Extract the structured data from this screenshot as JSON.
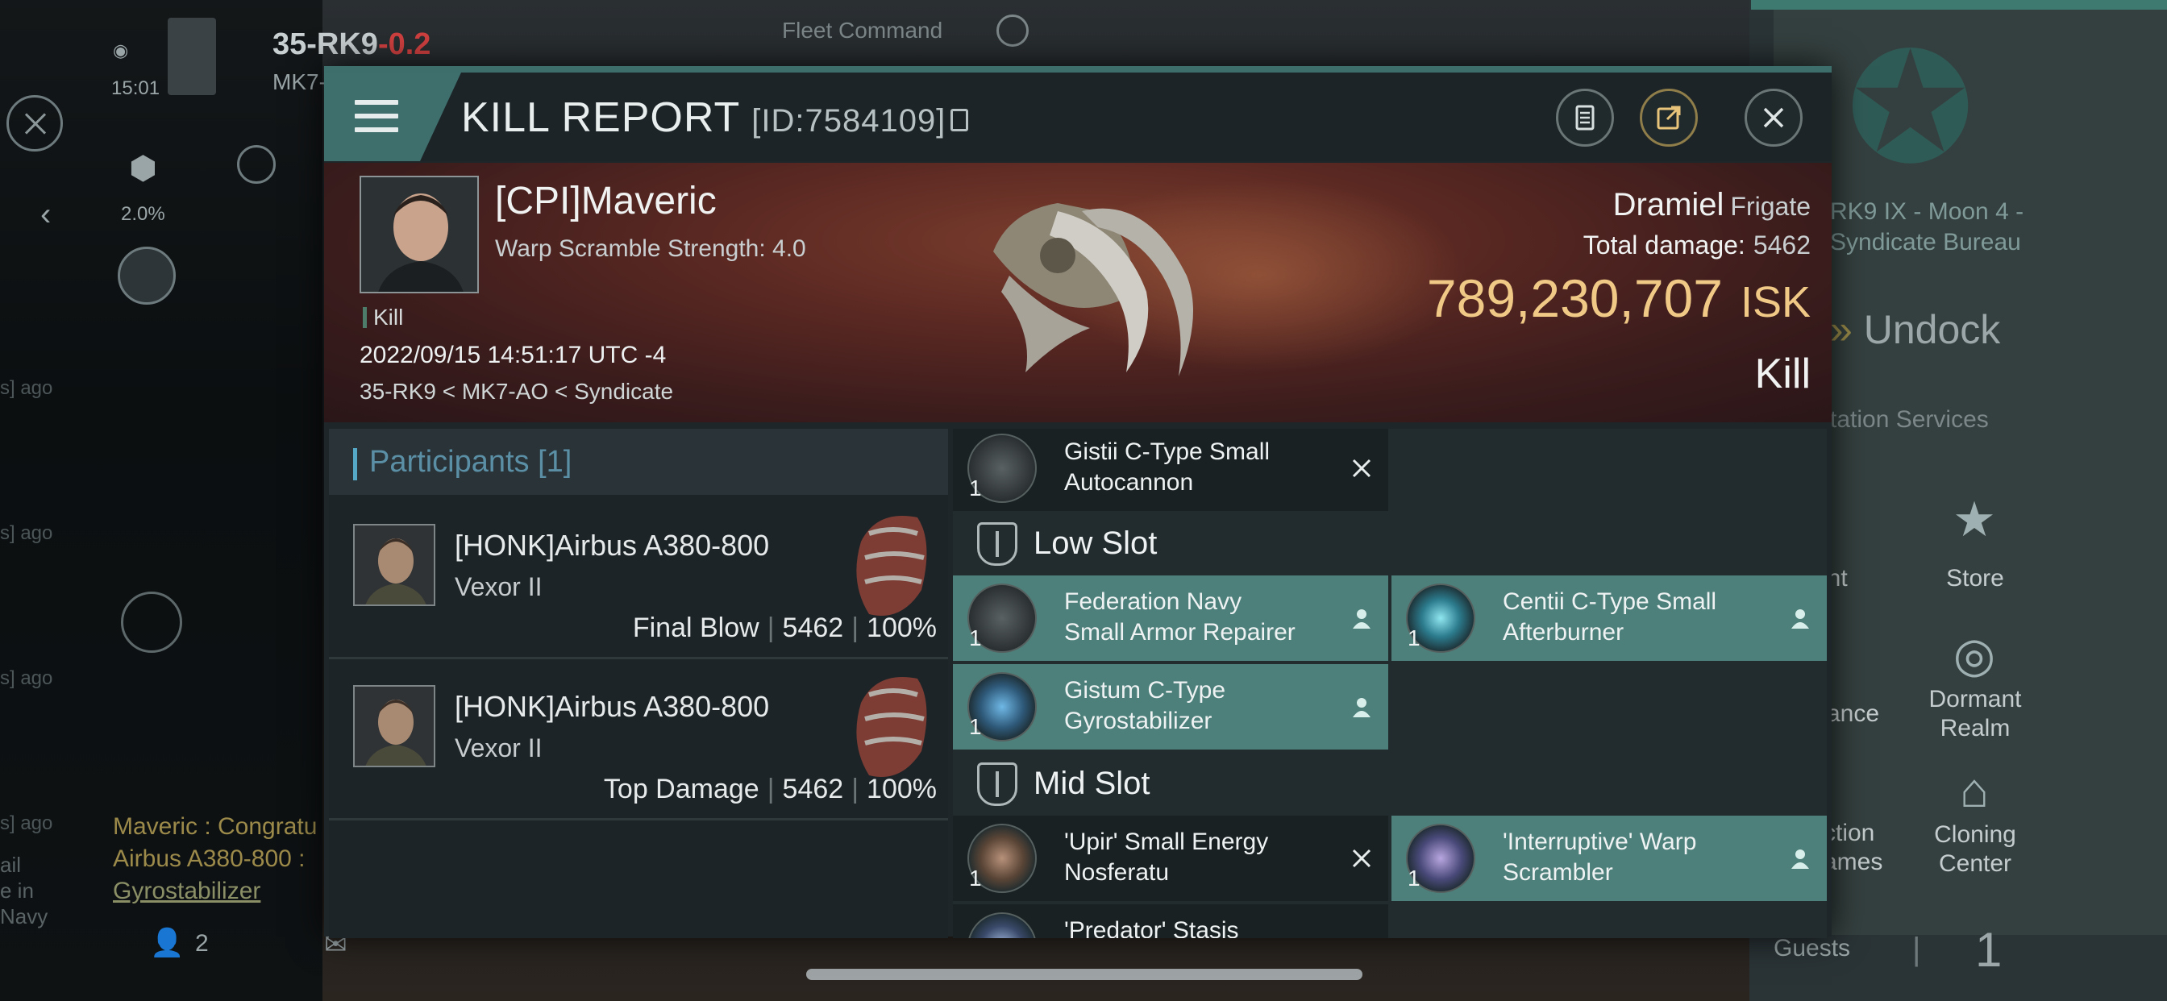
{
  "background": {
    "system": "35-RK9",
    "security": "-0.2",
    "region_short": "MK7-",
    "time": "15:01",
    "pct": "2.0%",
    "fleet": "Fleet Command",
    "station_name_1": "RK9 IX - Moon 4 -",
    "station_name_2": "Syndicate Bureau",
    "undock": "Undock",
    "station_services": "tation Services",
    "services": [
      {
        "label": "ent"
      },
      {
        "label": "Store"
      },
      {
        "label": "rance"
      },
      {
        "label": "Dormant\nRealm"
      },
      {
        "label": "ction\names"
      },
      {
        "label": "Cloning\nCenter"
      }
    ],
    "chat_1": "Maveric : Congratu",
    "chat_2": "Airbus A380-800 :",
    "chat_3": "Gyrostabilizer",
    "side_1": "ail",
    "side_2": "e in",
    "side_3": "Navy",
    "ago": "s] ago",
    "guests_label": "Guests",
    "guests_count": "1",
    "people_count": "2"
  },
  "header": {
    "title": "KILL REPORT",
    "id": "[ID:7584109]"
  },
  "victim": {
    "name": "[CPI]Maveric",
    "scramble": "Warp Scramble Strength: 4.0",
    "tag": "Kill",
    "datetime": "2022/09/15 14:51:17 UTC -4",
    "location": "35-RK9 < MK7-AO < Syndicate",
    "ship": "Dramiel",
    "ship_class": "Frigate",
    "total_damage_label": "Total damage:",
    "total_damage": "5462",
    "isk_value": "789,230,707",
    "isk_unit": "ISK",
    "result": "Kill"
  },
  "participants": {
    "label": "Participants",
    "count": "[1]",
    "rows": [
      {
        "name": "[HONK]Airbus A380-800",
        "ship": "Vexor II",
        "tag": "Final Blow",
        "damage": "5462",
        "pct": "100%"
      },
      {
        "name": "[HONK]Airbus A380-800",
        "ship": "Vexor II",
        "tag": "Top Damage",
        "damage": "5462",
        "pct": "100%"
      }
    ]
  },
  "fitting": {
    "high_partial": {
      "line1": "Gistii C-Type Small",
      "line2": "Autocannon",
      "qty": "1"
    },
    "low_slot_label": "Low Slot",
    "low": [
      {
        "line1": "Federation Navy",
        "line2": "Small Armor Repairer",
        "qty": "1"
      },
      {
        "line1": "Centii C-Type Small",
        "line2": "Afterburner",
        "qty": "1"
      },
      {
        "line1": "Gistum C-Type",
        "line2": "Gyrostabilizer",
        "qty": "1"
      }
    ],
    "mid_slot_label": "Mid Slot",
    "mid": [
      {
        "line1": "'Upir' Small Energy",
        "line2": "Nosferatu",
        "qty": "1"
      },
      {
        "line1": "'Interruptive' Warp",
        "line2": "Scrambler",
        "qty": "1"
      },
      {
        "line1": "'Predator' Stasis",
        "line2": ""
      }
    ]
  }
}
